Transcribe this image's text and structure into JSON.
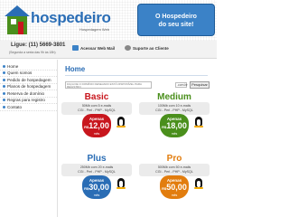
{
  "brand": {
    "name": "hospedeiro",
    "tagline": "Hospedagem Web",
    "slogan_line1": "O Hospedeiro",
    "slogan_line2": "do seu site!"
  },
  "topbar": {
    "phone": "Ligue: (11) 5669-3801",
    "phone_sub": "(Segunda a sexta das 9h às 18h)",
    "webmail_label": "Acessar Web Mail",
    "support_label": "Suporte ao Cliente"
  },
  "sidebar": {
    "items": [
      {
        "label": "Home"
      },
      {
        "label": "Quem somos"
      },
      {
        "label": "Pedido de hospedagem"
      },
      {
        "label": "Planos de hospedagem"
      },
      {
        "label": "Reserva de domínio"
      },
      {
        "label": "Regras para registro"
      },
      {
        "label": "Contato"
      }
    ]
  },
  "main": {
    "title": "Home",
    "search_hint": "FAÇA DE O DOMÍNIO DESEJADO ESTÁ DISPONÍVEL PARA REGISTRO",
    "select_value": ".com.br",
    "search_button": "Pesquisar"
  },
  "plans": [
    {
      "name": "Basic",
      "desc1": "50Mb com 5 e-mails",
      "desc2": "CGI - Perl - PHP - MySQL",
      "apenas": "Apenas",
      "currency": "R$",
      "price": "12,00",
      "period": "mês",
      "color": "#c8161d"
    },
    {
      "name": "Medium",
      "desc1": "100Mb com 10 e-mails",
      "desc2": "CGI - Perl - PHP - MySQL",
      "apenas": "Apenas",
      "currency": "R$",
      "price": "18,00",
      "period": "mês",
      "color": "#4a8f1c"
    },
    {
      "name": "Plus",
      "desc1": "250Mb com 20 e-mails",
      "desc2": "CGI - Perl - PHP - MySQL",
      "apenas": "Apenas",
      "currency": "R$",
      "price": "30,00",
      "period": "mês",
      "color": "#2a6db5"
    },
    {
      "name": "Pro",
      "desc1": "500Mb com 50 e-mails",
      "desc2": "CGI - Perl - PHP - MySQL",
      "apenas": "Apenas",
      "currency": "R$",
      "price": "50,00",
      "period": "mês",
      "color": "#e27d0e"
    }
  ]
}
